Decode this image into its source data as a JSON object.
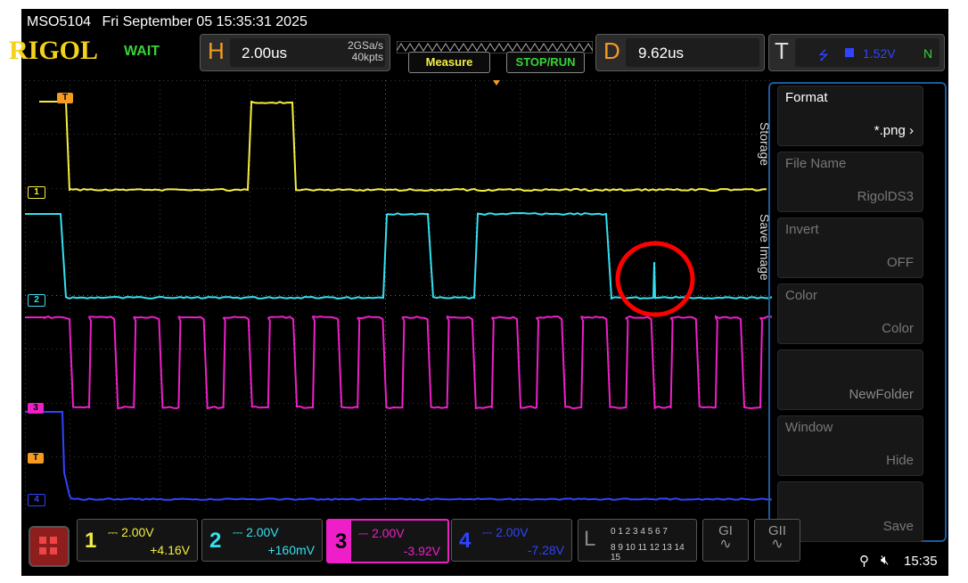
{
  "header": {
    "model": "MSO5104",
    "datetime": "Fri September 05 15:35:31 2025"
  },
  "brand": {
    "logo": "RIGOL",
    "status": "WAIT"
  },
  "horizontal": {
    "letter": "H",
    "timebase": "2.00us",
    "sample_rate": "2GSa/s",
    "memory_depth": "40kpts"
  },
  "buttons": {
    "measure": "Measure",
    "stop_run": "STOP/RUN"
  },
  "delay": {
    "letter": "D",
    "value": "9.62us"
  },
  "trigger": {
    "letter": "T",
    "level": "1.52V",
    "mode": "N",
    "icon": "rising-edge-icon"
  },
  "side_menu": {
    "tabs": [
      "Storage",
      "Save Image"
    ],
    "items": [
      {
        "title": "Format",
        "value": "*.png"
      },
      {
        "title": "File Name",
        "value": "RigolDS3"
      },
      {
        "title": "Invert",
        "value": "OFF"
      },
      {
        "title": "Color",
        "value": "Color"
      },
      {
        "title": "",
        "value": "NewFolder"
      },
      {
        "title": "Window",
        "value": "Hide"
      },
      {
        "title": "",
        "value": "Save"
      }
    ]
  },
  "channels": [
    {
      "num": "1",
      "scale": "2.00V",
      "offset": "+4.16V",
      "color": "#f4ee42"
    },
    {
      "num": "2",
      "scale": "2.00V",
      "offset": "+160mV",
      "color": "#35e0f0"
    },
    {
      "num": "3",
      "scale": "2.00V",
      "offset": "-3.92V",
      "color": "#ee1fc9"
    },
    {
      "num": "4",
      "scale": "2.00V",
      "offset": "-7.28V",
      "color": "#2f44ff"
    }
  ],
  "logic": {
    "letter": "L",
    "row1": "0 1 2 3  4 5 6 7",
    "row2": "8 9 10 11 12 13 14 15"
  },
  "gen": {
    "g1": "GI",
    "g2": "GII"
  },
  "status_bar": {
    "time": "15:35",
    "usb_icon": "usb-icon",
    "mute_icon": "speaker-muted-icon"
  },
  "markers": {
    "ch1": "1",
    "ch2": "2",
    "ch3": "3",
    "ch4": "4",
    "trig": "T"
  },
  "colors": {
    "ch1": "#f4ee42",
    "ch2": "#35e0f0",
    "ch3": "#ee1fc9",
    "ch4": "#2f44ff",
    "trigger": "#f59a23",
    "annotation": "#ff0000"
  }
}
